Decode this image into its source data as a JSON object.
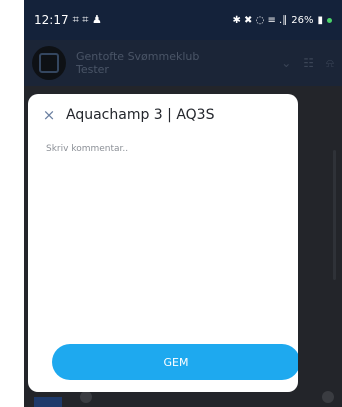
{
  "status_bar": {
    "time": "12:17",
    "left_icons": "⌗ ⌗ ♟",
    "right_icons": "✱ ✖ ◌ ≡ .∥",
    "battery": "26%"
  },
  "app_bar": {
    "club_line1": "Gentofte Svømmeklub",
    "club_line2": "Tester",
    "chevron_icon": "⌄",
    "grid_icon": "☷",
    "bell_icon": "⍾"
  },
  "modal": {
    "close_icon": "×",
    "title": "Aquachamp 3 | AQ3S",
    "comment_placeholder": "Skriv kommentar..",
    "comment_value": "",
    "save_label": "GEM"
  },
  "colors": {
    "accent": "#1ea9ef",
    "status_bar": "#14223a",
    "dim_background": "#1d1e22"
  }
}
